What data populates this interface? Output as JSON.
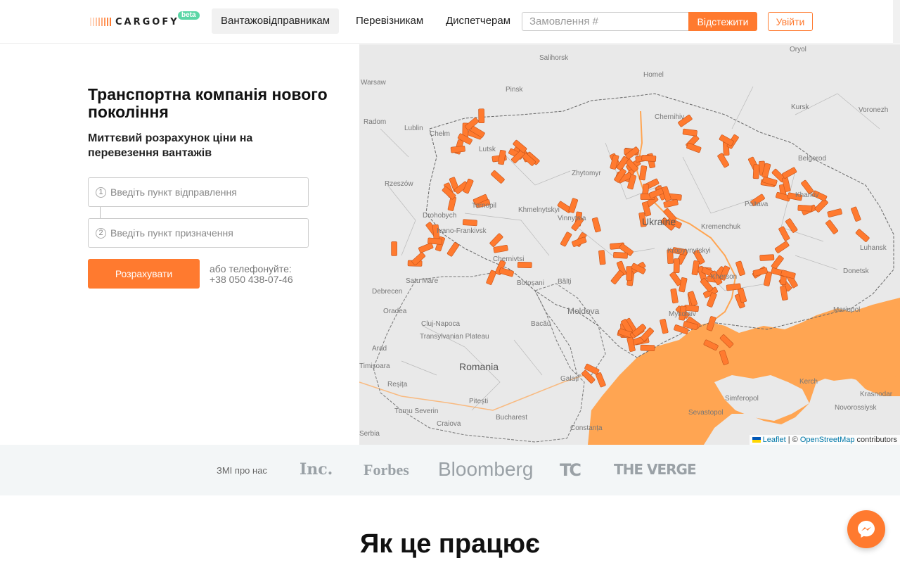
{
  "brand": {
    "name": "CARGOFY",
    "badge": "beta",
    "accent": "#ff7a2f"
  },
  "nav": {
    "items": [
      {
        "label": "Вантажовідправникам",
        "active": true
      },
      {
        "label": "Перевізникам",
        "active": false
      },
      {
        "label": "Диспетчерам",
        "active": false
      }
    ],
    "track_placeholder": "Замовлення #",
    "track_button": "Відстежити",
    "login_button": "Увійти"
  },
  "hero": {
    "title": "Транспортна компанія нового покоління",
    "subtitle": "Миттєвий розрахунок ціни на перевезення вантажів",
    "from": {
      "number": "1",
      "placeholder": "Введіть пункт відправлення"
    },
    "to": {
      "number": "2",
      "placeholder": "Введіть пункт призначення"
    },
    "calculate_button": "Розрахувати",
    "phone_label": "або телефонуйте:",
    "phone": "+38 050 438-07-46"
  },
  "map": {
    "labels": [
      "Warsaw",
      "Radom",
      "Lublin",
      "Chełm",
      "Rzeszów",
      "Drohobych",
      "Ivano-Frankivsk",
      "Chernivtsi",
      "Satu Mare",
      "Debrecen",
      "Oradea",
      "Cluj-Napoca",
      "Transylvanian Plateau",
      "Arad",
      "Timișoara",
      "Reșița",
      "Turnu Severin",
      "Craiova",
      "Pitești",
      "Bucharest",
      "Constanța",
      "Galați",
      "Bacău",
      "Moldova",
      "Bălți",
      "Botoșani",
      "Romania",
      "Lutsk",
      "Ternopil",
      "Khmelnytskyi",
      "Vinnytsia",
      "Zhytomyr",
      "Ukraine",
      "Kremenchuk",
      "Kropyvnytskyi",
      "Mykolaiv",
      "Kherson",
      "Poltava",
      "Kharkiv",
      "Donetsk",
      "Luhansk",
      "Mariupol",
      "Kerch",
      "Simferopol",
      "Sevastopol",
      "Krasnodar",
      "Novorossiysk",
      "Kursk",
      "Belgorod",
      "Voronezh",
      "Oryol",
      "Homel",
      "Pinsk",
      "Salihorsk",
      "Chernihiv",
      "Serbia"
    ],
    "attribution": {
      "leaflet": "Leaflet",
      "separator": " | © ",
      "osm": "OpenStreetMap",
      "suffix": " contributors"
    },
    "colors": {
      "land": "#e9e9e9",
      "sea": "#ffa552",
      "markers": "#ff7a2f"
    }
  },
  "media": {
    "label": "ЗМІ про нас",
    "logos": [
      "Inc.",
      "Forbes",
      "Bloomberg",
      "TC",
      "THE VERGE"
    ]
  },
  "section": {
    "title": "Як це працює"
  }
}
